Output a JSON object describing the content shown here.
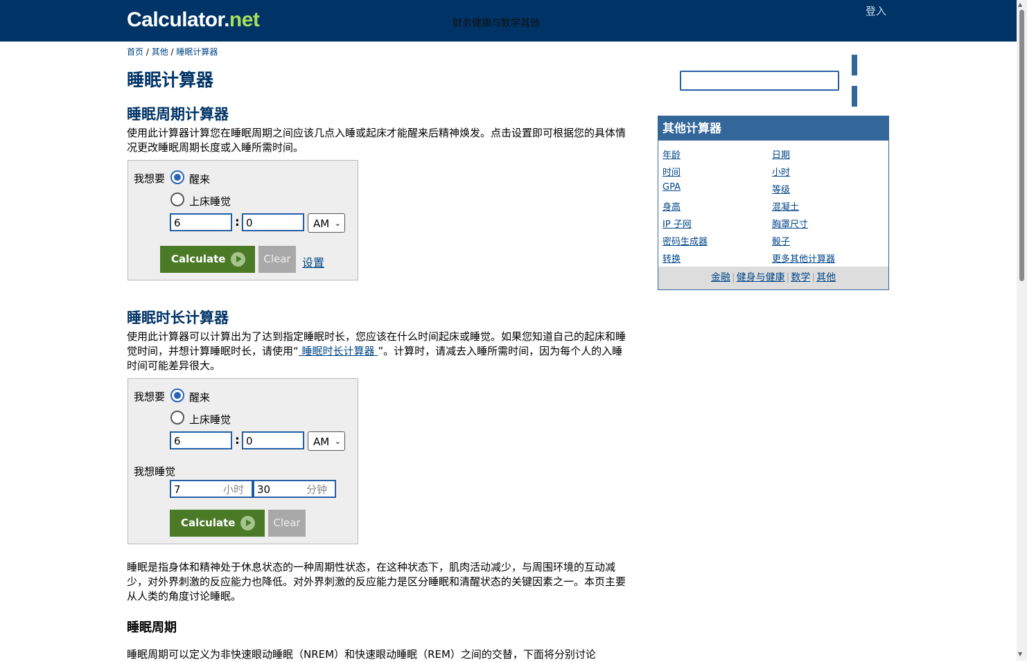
{
  "header": {
    "logo_main": "Calculator",
    "logo_dot": ".",
    "logo_net": "net",
    "tagline": "财务健康与数学其他",
    "login": "登入"
  },
  "breadcrumb": {
    "home": "首页",
    "sep1": " / ",
    "other": "其他",
    "sep2": " / ",
    "current": "睡眠计算器"
  },
  "page_title": "睡眠计算器",
  "cycle_section": {
    "heading": "睡眠周期计算器",
    "description": "使用此计算器计算您在睡眠周期之间应该几点入睡或起床才能醒来后精神焕发。点击设置即可根据您的具体情况更改睡眠周期长度或入睡所需时间。",
    "form": {
      "i_want": "我想要",
      "opt_wake": "醒来",
      "opt_sleep": "上床睡觉",
      "selected": "醒来",
      "hour": "6",
      "minute": "0",
      "ampm": "AM",
      "calculate": "Calculate",
      "clear": "Clear",
      "settings": "设置"
    }
  },
  "duration_section": {
    "heading": "睡眠时长计算器",
    "desc_before": "使用此计算器可以计算出为了达到指定睡眠时长，您应该在什么时间起床或睡觉。如果您知道自己的起床和睡觉时间，并想计算睡眠时长，请使用“",
    "desc_link": " 睡眠时长计算器 ",
    "desc_after": "”。计算时，请减去入睡所需时间，因为每个人的入睡时间可能差异很大。",
    "form": {
      "i_want": "我想要",
      "opt_wake": "醒来",
      "opt_sleep": "上床睡觉",
      "selected": "醒来",
      "hour": "6",
      "minute": "0",
      "ampm": "AM",
      "i_want_sleep": "我想睡觉",
      "sleep_hours": "7",
      "hours_unit": "小时",
      "sleep_minutes": "30",
      "minutes_unit": "分钟",
      "calculate": "Calculate",
      "clear": "Clear"
    }
  },
  "intro_paragraph": "睡眠是指身体和精神处于休息状态的一种周期性状态，在这种状态下，肌肉活动减少，与周围环境的互动减少，对外界刺激的反应能力也降低。对外界刺激的反应能力是区分睡眠和清醒状态的关键因素之一。本页主要从人类的角度讨论睡眠。",
  "sleep_cycle_heading": "睡眠周期",
  "sleep_cycle_paragraph": "睡眠周期可以定义为非快速眼动睡眠（NREM）和快速眼动睡眠（REM）之间的交替，下面将分别讨论",
  "sidebar": {
    "search_value": "",
    "other_title": "其他计算器",
    "links_left": [
      "年龄",
      "时间",
      "GPA",
      "身高",
      "IP 子网",
      "密码生成器",
      "转换"
    ],
    "links_right": [
      "日期",
      "小时",
      "等级",
      "混凝土",
      "胸罩尺寸",
      "骰子",
      "更多其他计算器"
    ],
    "footer_links": [
      "金融",
      "健身与健康",
      "数学",
      "其他"
    ],
    "footer_sep": "|"
  }
}
